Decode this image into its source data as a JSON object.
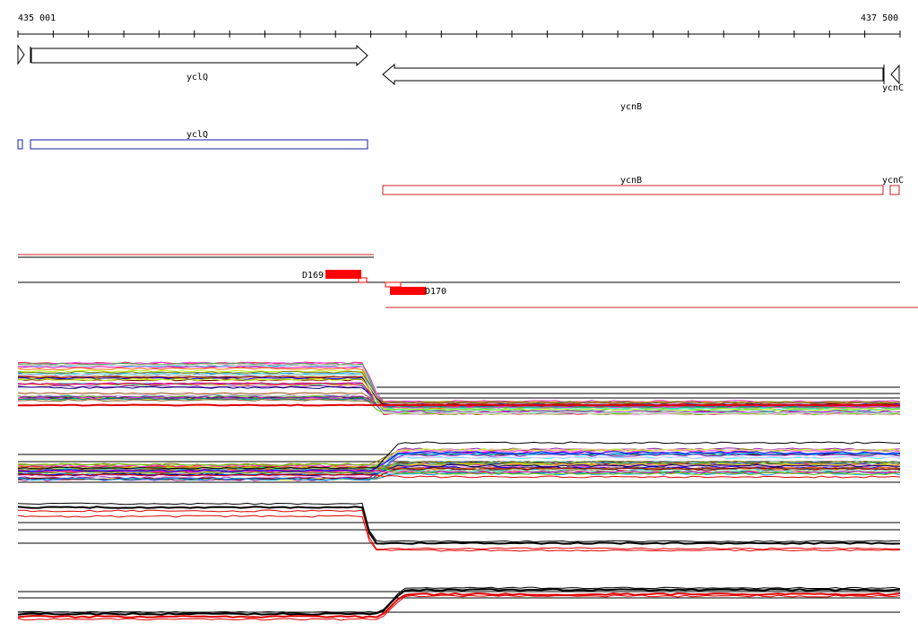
{
  "ruler": {
    "start_label": "435 001",
    "end_label": "437 500"
  },
  "genes": {
    "yclQ": "yclQ",
    "ycnB": "ycnB",
    "ycnC": "ycnC"
  },
  "transcripts": {
    "yclQ": "yclQ",
    "ycnB": "ycnB",
    "ycnC": "ycnC"
  },
  "features": {
    "d169": "D169",
    "d170": "D170"
  },
  "colors": {
    "arrow": "#000000",
    "transcript_forward": "#1a1aa6",
    "transcript_reverse": "#cc2222",
    "feature": "#ff0000",
    "trace_highlight": "#e00000"
  }
}
